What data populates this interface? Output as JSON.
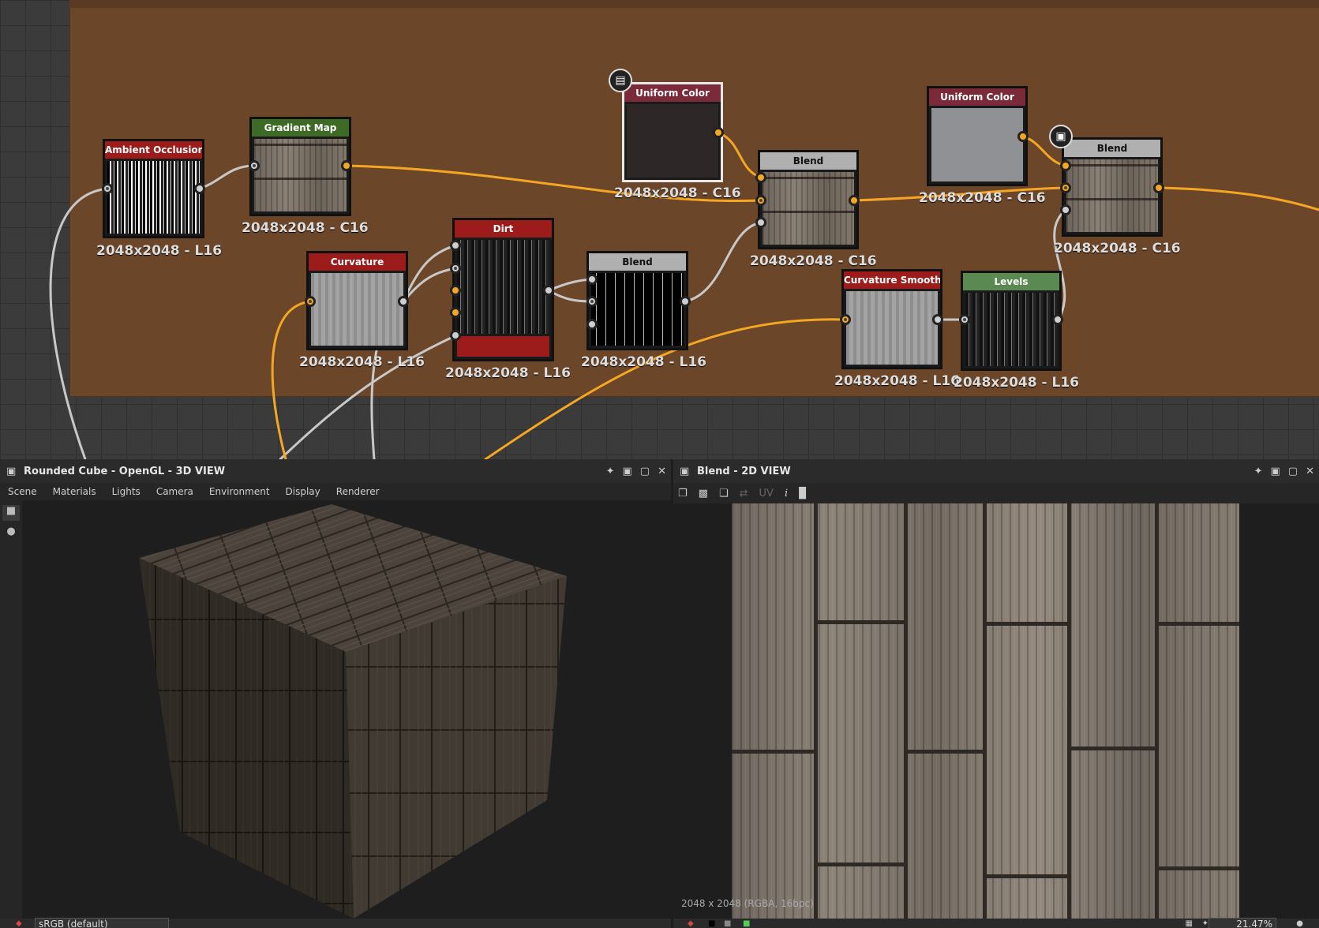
{
  "graph": {
    "nodes": {
      "ambient_occlusion": {
        "title": "Ambient Occlusion ...",
        "res": "2048x2048 - L16",
        "color": "#9c1c1c"
      },
      "gradient_map": {
        "title": "Gradient Map",
        "res": "2048x2048 - C16",
        "color": "#3d6b25"
      },
      "curvature": {
        "title": "Curvature",
        "res": "2048x2048 - L16",
        "color": "#9c1c1c"
      },
      "dirt": {
        "title": "Dirt",
        "res": "2048x2048 - L16",
        "color": "#9c1c1c"
      },
      "blend_1": {
        "title": "Blend",
        "res": "2048x2048 - L16",
        "color": "#b0b0b0"
      },
      "uniform_color_1": {
        "title": "Uniform Color",
        "res": "2048x2048 - C16",
        "color": "#7a2a38"
      },
      "blend_2": {
        "title": "Blend",
        "res": "2048x2048 - C16",
        "color": "#b0b0b0"
      },
      "uniform_color_2": {
        "title": "Uniform Color",
        "res": "2048x2048 - C16",
        "color": "#7a2a38"
      },
      "blend_3": {
        "title": "Blend",
        "res": "2048x2048 - C16",
        "color": "#b0b0b0"
      },
      "curvature_smooth": {
        "title": "Curvature Smooth",
        "res": "2048x2048 - L16",
        "color": "#9c1c1c"
      },
      "levels": {
        "title": "Levels",
        "res": "2048x2048 - L16",
        "color": "#5a8a52"
      }
    },
    "icons": {
      "output_badge": "document-icon",
      "blend_badge": "checker-icon"
    }
  },
  "view3d": {
    "title": "Rounded Cube - OpenGL - 3D VIEW",
    "menu": [
      "Scene",
      "Materials",
      "Lights",
      "Camera",
      "Environment",
      "Display",
      "Renderer"
    ],
    "colorspace": "sRGB (default)"
  },
  "view2d": {
    "title": "Blend - 2D VIEW",
    "uv_label": "UV",
    "info": "2048 x 2048 (RGBA, 16bpc)",
    "zoom": "21.47%"
  },
  "colors": {
    "wire_grey": "#c8c8c8",
    "wire_orange": "#f5a623",
    "frame": "#6b4629"
  }
}
